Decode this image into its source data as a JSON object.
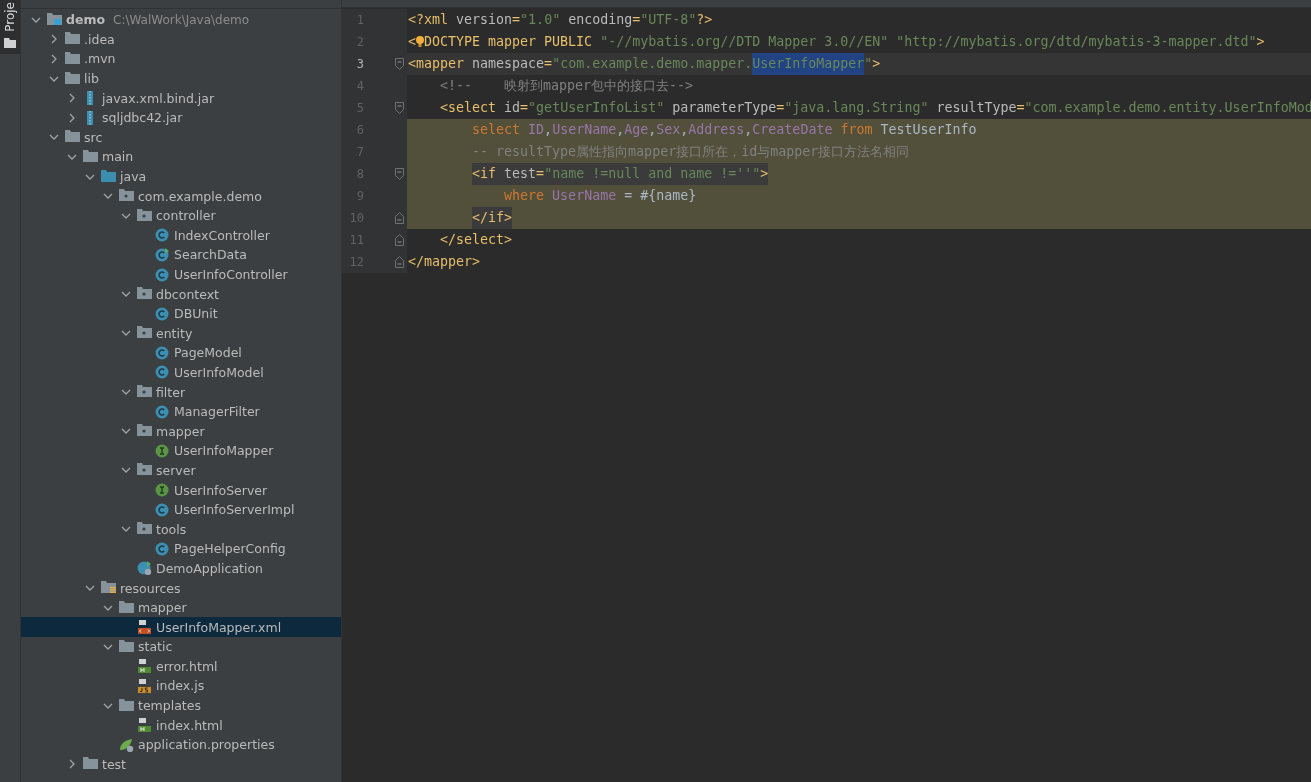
{
  "tool_strip": {
    "label": "Proje"
  },
  "project_tree": {
    "items": [
      {
        "label": "demo",
        "path": "C:\\WalWork\\Java\\demo",
        "kind": "module",
        "expanded": true,
        "selected": false,
        "children": [
          {
            "label": ".idea",
            "kind": "folder",
            "expanded": false,
            "selected": false
          },
          {
            "label": ".mvn",
            "kind": "folder",
            "expanded": false,
            "selected": false
          },
          {
            "label": "lib",
            "kind": "folder",
            "expanded": true,
            "selected": false,
            "children": [
              {
                "label": "javax.xml.bind.jar",
                "kind": "jar",
                "expanded": false,
                "selected": false
              },
              {
                "label": "sqljdbc42.jar",
                "kind": "jar",
                "expanded": false,
                "selected": false
              }
            ]
          },
          {
            "label": "src",
            "kind": "folder",
            "expanded": true,
            "selected": false,
            "children": [
              {
                "label": "main",
                "kind": "folder",
                "expanded": true,
                "selected": false,
                "children": [
                  {
                    "label": "java",
                    "kind": "source",
                    "expanded": true,
                    "selected": false,
                    "children": [
                      {
                        "label": "com.example.demo",
                        "kind": "package",
                        "expanded": true,
                        "selected": false,
                        "children": [
                          {
                            "label": "controller",
                            "kind": "package",
                            "expanded": true,
                            "selected": false,
                            "children": [
                              {
                                "label": "IndexController",
                                "kind": "class",
                                "selected": false
                              },
                              {
                                "label": "SearchData",
                                "kind": "runnable",
                                "selected": false
                              },
                              {
                                "label": "UserInfoController",
                                "kind": "class",
                                "selected": false
                              }
                            ]
                          },
                          {
                            "label": "dbcontext",
                            "kind": "package",
                            "expanded": true,
                            "selected": false,
                            "children": [
                              {
                                "label": "DBUnit",
                                "kind": "class",
                                "selected": false
                              }
                            ]
                          },
                          {
                            "label": "entity",
                            "kind": "package",
                            "expanded": true,
                            "selected": false,
                            "children": [
                              {
                                "label": "PageModel",
                                "kind": "class",
                                "selected": false
                              },
                              {
                                "label": "UserInfoModel",
                                "kind": "class",
                                "selected": false
                              }
                            ]
                          },
                          {
                            "label": "filter",
                            "kind": "package",
                            "expanded": true,
                            "selected": false,
                            "children": [
                              {
                                "label": "ManagerFilter",
                                "kind": "class",
                                "selected": false
                              }
                            ]
                          },
                          {
                            "label": "mapper",
                            "kind": "package",
                            "expanded": true,
                            "selected": false,
                            "children": [
                              {
                                "label": "UserInfoMapper",
                                "kind": "interface",
                                "selected": false
                              }
                            ]
                          },
                          {
                            "label": "server",
                            "kind": "package",
                            "expanded": true,
                            "selected": false,
                            "children": [
                              {
                                "label": "UserInfoServer",
                                "kind": "interface",
                                "selected": false
                              },
                              {
                                "label": "UserInfoServerImpl",
                                "kind": "class",
                                "selected": false
                              }
                            ]
                          },
                          {
                            "label": "tools",
                            "kind": "package",
                            "expanded": true,
                            "selected": false,
                            "children": [
                              {
                                "label": "PageHelperConfig",
                                "kind": "class",
                                "selected": false
                              }
                            ]
                          },
                          {
                            "label": "DemoApplication",
                            "kind": "app",
                            "selected": false
                          }
                        ]
                      }
                    ]
                  },
                  {
                    "label": "resources",
                    "kind": "resources",
                    "expanded": true,
                    "selected": false,
                    "children": [
                      {
                        "label": "mapper",
                        "kind": "folder",
                        "expanded": true,
                        "selected": false,
                        "children": [
                          {
                            "label": "UserInfoMapper.xml",
                            "kind": "xml",
                            "selected": true
                          }
                        ]
                      },
                      {
                        "label": "static",
                        "kind": "folder",
                        "expanded": true,
                        "selected": false,
                        "children": [
                          {
                            "label": "error.html",
                            "kind": "html",
                            "selected": false
                          },
                          {
                            "label": "index.js",
                            "kind": "js",
                            "selected": false
                          }
                        ]
                      },
                      {
                        "label": "templates",
                        "kind": "folder",
                        "expanded": true,
                        "selected": false,
                        "children": [
                          {
                            "label": "index.html",
                            "kind": "html",
                            "selected": false
                          }
                        ]
                      },
                      {
                        "label": "application.properties",
                        "kind": "properties",
                        "selected": false
                      }
                    ]
                  }
                ]
              },
              {
                "label": "test",
                "kind": "folder",
                "expanded": false,
                "selected": false
              }
            ]
          }
        ]
      }
    ]
  },
  "editor": {
    "lines": [
      {
        "number": "1",
        "current": false,
        "injected": false,
        "fold_start": false,
        "fold_end": false,
        "tokens": [
          {
            "text": "<?xml ",
            "kind": "tag"
          },
          {
            "text": "version",
            "kind": "attr"
          },
          {
            "text": "=",
            "kind": "tag"
          },
          {
            "text": "\"1.0\"",
            "kind": "str"
          },
          {
            "text": " encoding",
            "kind": "attr"
          },
          {
            "text": "=",
            "kind": "tag"
          },
          {
            "text": "\"UTF-8\"",
            "kind": "str"
          },
          {
            "text": "?>",
            "kind": "tag"
          }
        ]
      },
      {
        "number": "2",
        "current": false,
        "injected": false,
        "fold_start": false,
        "fold_end": false,
        "tokens": [
          {
            "text": "<",
            "kind": "tag"
          },
          {
            "text": "DOCTYPE mapper PUBLIC ",
            "kind": "tag",
            "lightbulb": true
          },
          {
            "text": "\"-//mybatis.org//DTD Mapper 3.0//EN\"",
            "kind": "str"
          },
          {
            "text": " \"http://mybatis.org/dtd/mybatis-3-mapper.dtd\"",
            "kind": "str"
          },
          {
            "text": ">",
            "kind": "tag"
          }
        ]
      },
      {
        "number": "3",
        "current": true,
        "injected": false,
        "fold_start": true,
        "fold_end": false,
        "tokens": [
          {
            "text": "<mapper ",
            "kind": "tag"
          },
          {
            "text": "namespace",
            "kind": "attr"
          },
          {
            "text": "=",
            "kind": "tag"
          },
          {
            "text": "\"com.example.demo.mapper.",
            "kind": "str"
          },
          {
            "text": "UserInfoMapper",
            "kind": "str",
            "selected": true
          },
          {
            "text": "\"",
            "kind": "str"
          },
          {
            "text": ">",
            "kind": "tag"
          }
        ]
      },
      {
        "number": "4",
        "current": false,
        "injected": false,
        "fold_start": false,
        "fold_end": false,
        "tokens": [
          {
            "text": "    <!--    映射到mapper包中的接口去-->",
            "kind": "comment"
          }
        ]
      },
      {
        "number": "5",
        "current": false,
        "injected": false,
        "fold_start": true,
        "fold_end": false,
        "tokens": [
          {
            "text": "    <select ",
            "kind": "tag"
          },
          {
            "text": "id",
            "kind": "attr"
          },
          {
            "text": "=",
            "kind": "tag"
          },
          {
            "text": "\"getUserInfoList\"",
            "kind": "str"
          },
          {
            "text": " parameterType",
            "kind": "attr"
          },
          {
            "text": "=",
            "kind": "tag"
          },
          {
            "text": "\"java.lang.String\"",
            "kind": "str"
          },
          {
            "text": " resultType",
            "kind": "attr"
          },
          {
            "text": "=",
            "kind": "tag"
          },
          {
            "text": "\"com.example.demo.entity.UserInfoMod",
            "kind": "str"
          }
        ]
      },
      {
        "number": "6",
        "current": false,
        "injected": true,
        "fold_start": false,
        "fold_end": false,
        "tokens": [
          {
            "text": "        select ",
            "kind": "keyword"
          },
          {
            "text": "ID",
            "kind": "column"
          },
          {
            "text": ",",
            "kind": "plain"
          },
          {
            "text": "UserName",
            "kind": "column"
          },
          {
            "text": ",",
            "kind": "plain"
          },
          {
            "text": "Age",
            "kind": "column"
          },
          {
            "text": ",",
            "kind": "plain"
          },
          {
            "text": "Sex",
            "kind": "column"
          },
          {
            "text": ",",
            "kind": "plain"
          },
          {
            "text": "Address",
            "kind": "column"
          },
          {
            "text": ",",
            "kind": "plain"
          },
          {
            "text": "CreateDate",
            "kind": "column"
          },
          {
            "text": " from ",
            "kind": "keyword"
          },
          {
            "text": "TestUserInfo",
            "kind": "plain"
          }
        ]
      },
      {
        "number": "7",
        "current": false,
        "injected": true,
        "fold_start": false,
        "fold_end": false,
        "tokens": [
          {
            "text": "        -- resultType属性指向mapper接口所在，id与mapper接口方法名相同",
            "kind": "comment"
          }
        ]
      },
      {
        "number": "8",
        "current": false,
        "injected": true,
        "fold_start": true,
        "fold_end": false,
        "tokens": [
          {
            "text": "        <if ",
            "kind": "tag",
            "match": true
          },
          {
            "text": "test",
            "kind": "attr",
            "match": true
          },
          {
            "text": "=",
            "kind": "tag",
            "match": true
          },
          {
            "text": "\"name !=null and name !=''\"",
            "kind": "str",
            "match": true
          },
          {
            "text": ">",
            "kind": "tag",
            "match": true
          }
        ]
      },
      {
        "number": "9",
        "current": false,
        "injected": true,
        "fold_start": false,
        "fold_end": false,
        "tokens": [
          {
            "text": "            where ",
            "kind": "keyword"
          },
          {
            "text": "UserName",
            "kind": "column"
          },
          {
            "text": " = #{name}",
            "kind": "plain"
          }
        ]
      },
      {
        "number": "10",
        "current": false,
        "injected": true,
        "fold_start": false,
        "fold_end": true,
        "tokens": [
          {
            "text": "        </if>",
            "kind": "tag",
            "match": true
          }
        ]
      },
      {
        "number": "11",
        "current": false,
        "injected": false,
        "fold_start": false,
        "fold_end": true,
        "tokens": [
          {
            "text": "    </select>",
            "kind": "tag"
          }
        ]
      },
      {
        "number": "12",
        "current": false,
        "injected": false,
        "fold_start": false,
        "fold_end": true,
        "tokens": [
          {
            "text": "</mapper>",
            "kind": "tag"
          }
        ]
      }
    ]
  }
}
